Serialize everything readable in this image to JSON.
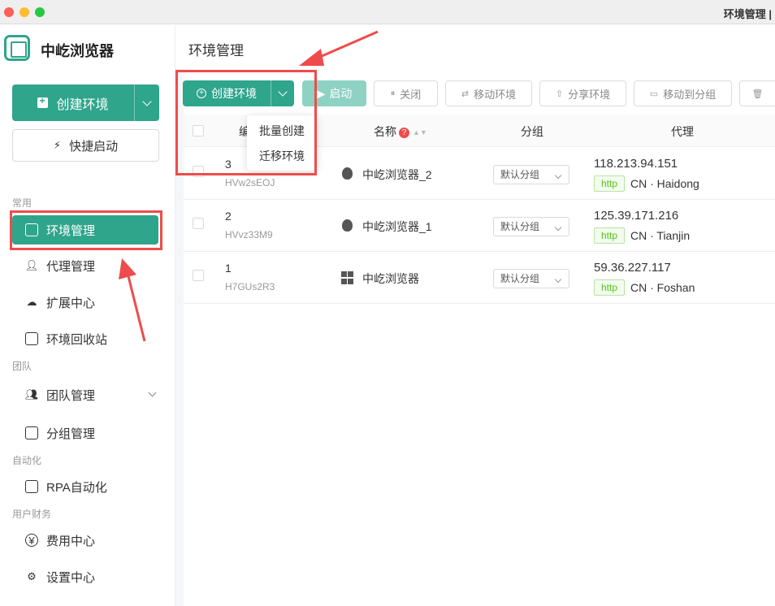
{
  "window": {
    "title": "环境管理 |"
  },
  "sidebar": {
    "brand": "中屹浏览器",
    "create_button": "创建环境",
    "quick_button": "快捷启动",
    "groups": {
      "common": "常用",
      "team": "团队",
      "automation": "自动化",
      "finance": "用户财务"
    },
    "items": {
      "env": "环境管理",
      "proxy": "代理管理",
      "ext": "扩展中心",
      "recycle": "环境回收站",
      "team_mgmt": "团队管理",
      "group_mgmt": "分组管理",
      "rpa": "RPA自动化",
      "billing": "费用中心",
      "settings": "设置中心"
    }
  },
  "main": {
    "page_title": "环境管理",
    "toolbar": {
      "create": "创建环境",
      "start": "启动",
      "close": "关闭",
      "move": "移动环境",
      "share": "分享环境",
      "move_group": "移动到分组"
    },
    "dropdown": [
      "批量创建",
      "迁移环境"
    ],
    "columns": {
      "seq": "编",
      "name": "名称",
      "group": "分组",
      "proxy": "代理"
    },
    "rows": [
      {
        "seq": "3",
        "id": "HVw2sEOJ",
        "os": "apple",
        "name": "中屹浏览器_2",
        "group": "默认分组",
        "ip": "118.213.94.151",
        "protocol": "http",
        "location": "CN · Haidong"
      },
      {
        "seq": "2",
        "id": "HVvz33M9",
        "os": "apple",
        "name": "中屹浏览器_1",
        "group": "默认分组",
        "ip": "125.39.171.216",
        "protocol": "http",
        "location": "CN · Tianjin"
      },
      {
        "seq": "1",
        "id": "H7GUs2R3",
        "os": "windows",
        "name": "中屹浏览器",
        "group": "默认分组",
        "ip": "59.36.227.117",
        "protocol": "http",
        "location": "CN · Foshan"
      }
    ]
  },
  "colors": {
    "accent": "#2fa58c",
    "annotation": "#ee4c4c",
    "http_tag": "#52c41a"
  }
}
